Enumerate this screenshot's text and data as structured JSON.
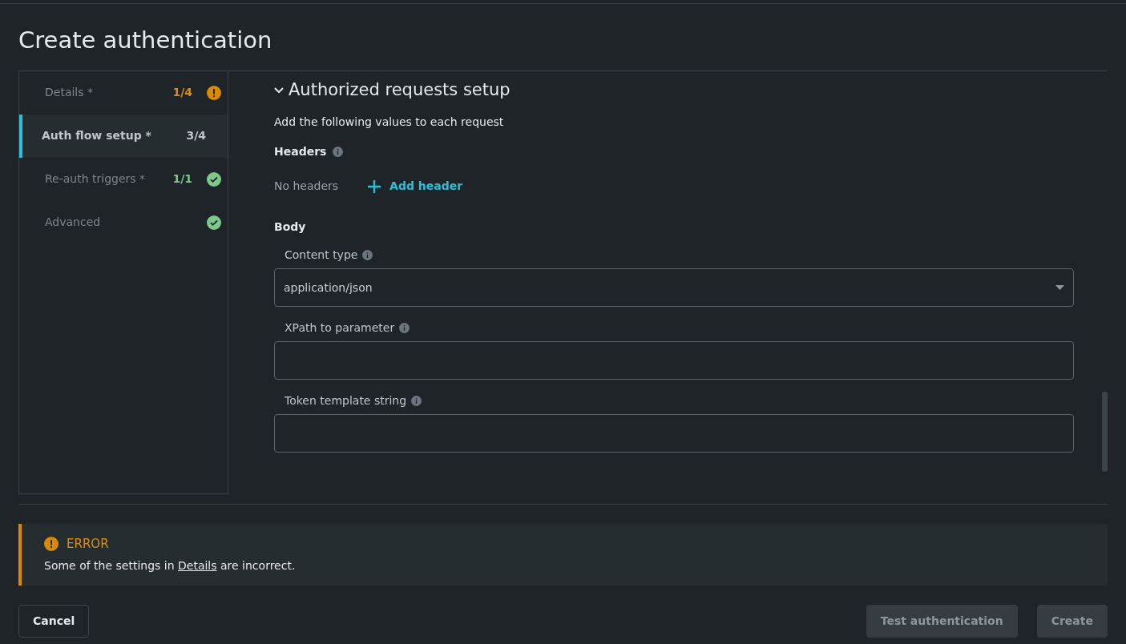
{
  "title": "Create authentication",
  "steps": [
    {
      "label": "Details *",
      "count": "1/4",
      "kind": "warning",
      "selected": false
    },
    {
      "label": "Auth flow setup *",
      "count": "3/4",
      "kind": "pending",
      "selected": true
    },
    {
      "label": "Re-auth triggers *",
      "count": "1/1",
      "kind": "done",
      "selected": false
    },
    {
      "label": "Advanced",
      "kind": "done",
      "selected": false
    }
  ],
  "section": {
    "title": "Authorized requests setup",
    "expanded": true,
    "intro": "Add the following values to each request",
    "headers": {
      "label": "Headers",
      "empty_text": "No headers",
      "add_label": "Add header"
    },
    "body": {
      "label": "Body",
      "fields": [
        {
          "kind": "select",
          "label": "Content type",
          "value": "application/json"
        },
        {
          "kind": "text",
          "label": "XPath to parameter"
        },
        {
          "kind": "text",
          "label": "Token template string"
        }
      ]
    }
  },
  "error": {
    "title": "ERROR",
    "text_before": "Some of the settings in ",
    "link": "Details",
    "text_after": " are incorrect."
  },
  "left_buttons": [
    {
      "label": "Cancel",
      "disabled": false
    }
  ],
  "right_buttons": [
    {
      "label": "Test authentication",
      "disabled": true
    },
    {
      "label": "Create",
      "disabled": true
    }
  ]
}
